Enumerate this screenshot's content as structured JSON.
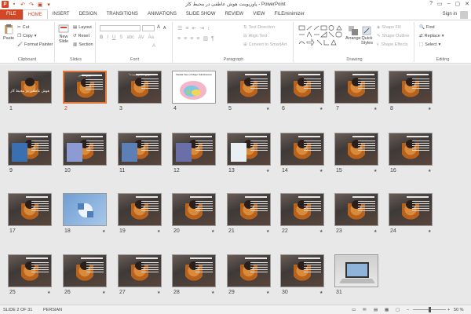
{
  "window": {
    "title": "پاورپوینت هوش عاطفی در محیط کار - PowerPoint",
    "controls": [
      "?",
      "▭",
      "–",
      "▢",
      "✕"
    ]
  },
  "tabs": [
    "FILE",
    "HOME",
    "INSERT",
    "DESIGN",
    "TRANSITIONS",
    "ANIMATIONS",
    "SLIDE SHOW",
    "REVIEW",
    "VIEW",
    "FILEminimizer"
  ],
  "active_tab": "HOME",
  "signin": "Sign in",
  "ribbon": {
    "clipboard": {
      "label": "Clipboard",
      "paste": "Paste",
      "cut": "Cut",
      "copy": "Copy",
      "format_painter": "Format Painter"
    },
    "slides": {
      "label": "Slides",
      "new_slide": "New",
      "new_slide2": "Slide",
      "layout": "Layout",
      "reset": "Reset",
      "section": "Section"
    },
    "font": {
      "label": "Font"
    },
    "paragraph": {
      "label": "Paragraph",
      "text_direction": "Text Direction",
      "align_text": "Align Text",
      "smartart": "Convert to SmartArt"
    },
    "drawing": {
      "label": "Drawing",
      "arrange": "Arrange",
      "quick_styles": "Quick",
      "quick_styles2": "Styles",
      "shape_fill": "Shape Fill",
      "shape_outline": "Shape Outline",
      "shape_effects": "Shape Effects"
    },
    "editing": {
      "label": "Editing",
      "find": "Find",
      "replace": "Replace",
      "select": "Select"
    }
  },
  "slides": [
    {
      "n": "1",
      "title": "هوش عاطفی در محیط کار",
      "star": false
    },
    {
      "n": "2",
      "title": "هوش عاطفی",
      "star": false,
      "selected": true
    },
    {
      "n": "3",
      "title": "هوش عاطفی چیست؟",
      "star": false
    },
    {
      "n": "4",
      "title": "Medial View of Major Subdivisions",
      "star": false
    },
    {
      "n": "5",
      "title": "",
      "star": true
    },
    {
      "n": "6",
      "title": "",
      "star": true
    },
    {
      "n": "7",
      "title": "",
      "star": true
    },
    {
      "n": "8",
      "title": "",
      "star": true
    },
    {
      "n": "9",
      "title": "",
      "star": false
    },
    {
      "n": "10",
      "title": "",
      "star": false
    },
    {
      "n": "11",
      "title": "",
      "star": false
    },
    {
      "n": "12",
      "title": "",
      "star": false
    },
    {
      "n": "13",
      "title": "",
      "star": true
    },
    {
      "n": "14",
      "title": "",
      "star": true
    },
    {
      "n": "15",
      "title": "",
      "star": true
    },
    {
      "n": "16",
      "title": "",
      "star": true
    },
    {
      "n": "17",
      "title": "",
      "star": false
    },
    {
      "n": "18",
      "title": "",
      "star": true
    },
    {
      "n": "19",
      "title": "",
      "star": true
    },
    {
      "n": "20",
      "title": "",
      "star": true
    },
    {
      "n": "21",
      "title": "",
      "star": true
    },
    {
      "n": "22",
      "title": "",
      "star": true
    },
    {
      "n": "23",
      "title": "",
      "star": true
    },
    {
      "n": "24",
      "title": "",
      "star": true
    },
    {
      "n": "25",
      "title": "",
      "star": true
    },
    {
      "n": "26",
      "title": "",
      "star": true
    },
    {
      "n": "27",
      "title": "",
      "star": true
    },
    {
      "n": "28",
      "title": "",
      "star": true
    },
    {
      "n": "29",
      "title": "",
      "star": true
    },
    {
      "n": "30",
      "title": "",
      "star": true
    },
    {
      "n": "31",
      "title": "",
      "star": false
    }
  ],
  "status": {
    "slide": "SLIDE 2 OF 31",
    "language": "PERSIAN",
    "zoom": "50 %"
  }
}
